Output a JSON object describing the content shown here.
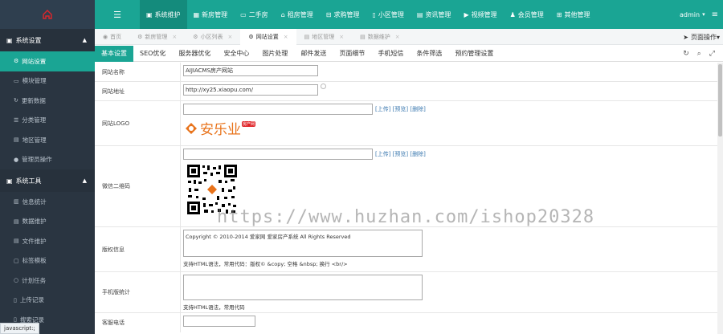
{
  "topbar": {
    "menu_toggle": "☰",
    "nav": [
      {
        "icon": "▣",
        "label": "系统维护",
        "active": true
      },
      {
        "icon": "▦",
        "label": "新房管理"
      },
      {
        "icon": "▭",
        "label": "二手房"
      },
      {
        "icon": "⌂",
        "label": "租房管理"
      },
      {
        "icon": "⊟",
        "label": "求购管理"
      },
      {
        "icon": "▯",
        "label": "小区管理"
      },
      {
        "icon": "▤",
        "label": "资讯管理"
      },
      {
        "icon": "▶",
        "label": "视频管理"
      },
      {
        "icon": "♟",
        "label": "会员管理"
      },
      {
        "icon": "⊞",
        "label": "其他管理"
      }
    ],
    "user": "admin",
    "caret": "▾",
    "burger": "≡"
  },
  "sidebar": {
    "section1": {
      "icon": "▣",
      "label": "系统设置",
      "arrow": "▲"
    },
    "items1": [
      {
        "icon": "⚙",
        "label": "网站设置",
        "active": true
      },
      {
        "icon": "▭",
        "label": "模块管理"
      },
      {
        "icon": "↻",
        "label": "更新数据"
      },
      {
        "icon": "☰",
        "label": "分类管理"
      },
      {
        "icon": "▤",
        "label": "地区管理"
      },
      {
        "icon": "●",
        "label": "管理员操作"
      }
    ],
    "section2": {
      "icon": "▣",
      "label": "系统工具",
      "arrow": "▲"
    },
    "items2": [
      {
        "icon": "▥",
        "label": "信息统计"
      },
      {
        "icon": "▤",
        "label": "数据维护"
      },
      {
        "icon": "▤",
        "label": "文件维护"
      },
      {
        "icon": "▢",
        "label": "标签模板"
      },
      {
        "icon": "○",
        "label": "计划任务"
      },
      {
        "icon": "▯",
        "label": "上传记录"
      },
      {
        "icon": "▯",
        "label": "搜索记录"
      }
    ],
    "status_tip": "javascript:;"
  },
  "tabs": [
    {
      "icon": "◉",
      "label": "首页",
      "closable": false
    },
    {
      "icon": "⚙",
      "label": "新房管理",
      "closable": true
    },
    {
      "icon": "⚙",
      "label": "小区列表",
      "closable": true
    },
    {
      "icon": "⚙",
      "label": "网站设置",
      "closable": true,
      "active": true
    },
    {
      "icon": "▤",
      "label": "地区管理",
      "closable": true
    },
    {
      "icon": "▤",
      "label": "数据维护",
      "closable": true
    }
  ],
  "tab_close": "×",
  "page_ops": {
    "icon": "➤",
    "label": "页面操作",
    "caret": "▾"
  },
  "subtabs": [
    "基本设置",
    "SEO优化",
    "服务器优化",
    "安全中心",
    "图片处理",
    "邮件发送",
    "页面细节",
    "手机短信",
    "条件筛选",
    "预约管理设置"
  ],
  "tools": {
    "refresh": "↻",
    "search": "⌕",
    "expand": "⤢"
  },
  "form": {
    "site_name": {
      "label": "网站名称",
      "value": "AIJIACMS房产网站"
    },
    "site_url": {
      "label": "网站地址",
      "value": "http://xy25.xiaopu.com/"
    },
    "site_logo": {
      "label": "网站LOGO",
      "value": "",
      "links": "[上传] [预览] [删除]",
      "brand": "安乐业",
      "brand_tag": "房产网"
    },
    "wechat_qr": {
      "label": "微信二维码",
      "value": "",
      "links": "[上传] [预览] [删除]"
    },
    "copyright": {
      "label": "版权信息",
      "value": "Copyright © 2010-2014 爱家网 爱家房产系统 All Rights Reserved",
      "hint": "支持HTML语法，常用代码：版权© &copy; 空格 &nbsp; 换行 <br/>"
    },
    "mobile_stats": {
      "label": "手机版统计",
      "value": "",
      "hint": "支持HTML语法，常用代码"
    },
    "service_phone": {
      "label": "客服电话",
      "value": ""
    }
  },
  "watermark": "https://www.huzhan.com/ishop20328",
  "colors": {
    "primary": "#1aa594",
    "sidebar": "#2a3541",
    "link": "#3d7ab0",
    "brand": "#e8731b"
  }
}
